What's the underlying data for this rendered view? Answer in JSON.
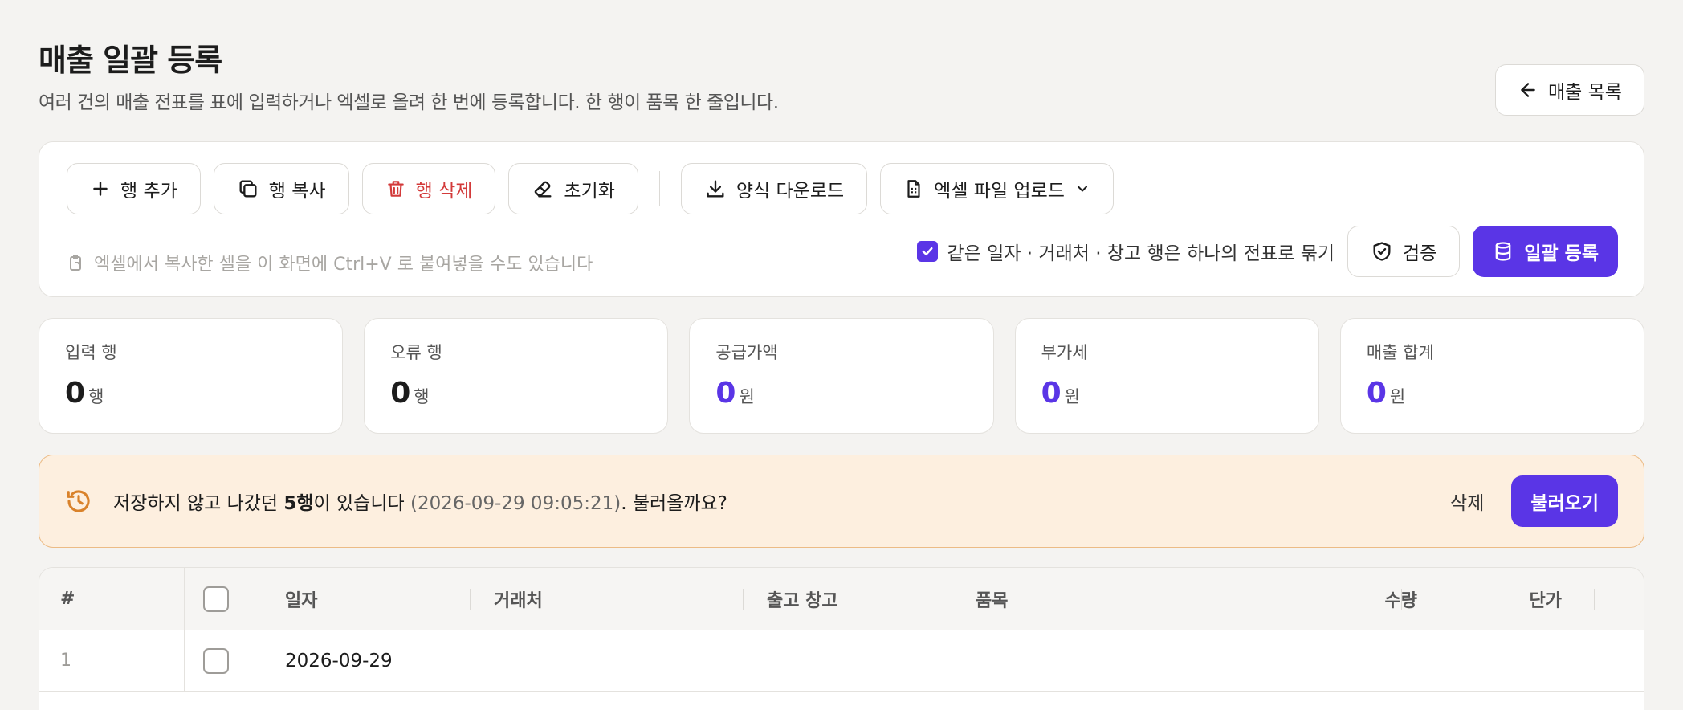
{
  "page": {
    "title": "매출 일괄 등록",
    "subtitle": "여러 건의 매출 전표를 표에 입력하거나 엑셀로 올려 한 번에 등록합니다. 한 행이 품목 한 줄입니다.",
    "back_label": "매출 목록"
  },
  "toolbar": {
    "add_row": "행 추가",
    "copy_row": "행 복사",
    "delete_row": "행 삭제",
    "reset": "초기화",
    "download_template": "양식 다운로드",
    "upload_excel": "엑셀 파일 업로드",
    "paste_hint": "엑셀에서 복사한 셀을 이 화면에 Ctrl+V 로 붙여넣을 수도 있습니다",
    "group_label": "같은 일자 · 거래처 · 창고 행은 하나의 전표로 묶기",
    "group_checked": true,
    "validate": "검증",
    "register": "일괄 등록"
  },
  "stats": [
    {
      "label": "입력 행",
      "value": "0",
      "unit": "행",
      "accent": false
    },
    {
      "label": "오류 행",
      "value": "0",
      "unit": "행",
      "accent": false
    },
    {
      "label": "공급가액",
      "value": "0",
      "unit": "원",
      "accent": true
    },
    {
      "label": "부가세",
      "value": "0",
      "unit": "원",
      "accent": true
    },
    {
      "label": "매출 합계",
      "value": "0",
      "unit": "원",
      "accent": true
    }
  ],
  "banner": {
    "prefix": "저장하지 않고 나갔던 ",
    "count": "5행",
    "middle": "이 있습니다 ",
    "timestamp": "(2026-09-29 09:05:21)",
    "suffix": ". 불러올까요?",
    "delete_label": "삭제",
    "load_label": "불러오기"
  },
  "table": {
    "headers": {
      "index": "#",
      "date": "일자",
      "customer": "거래처",
      "warehouse": "출고 창고",
      "item": "품목",
      "qty": "수량",
      "price": "단가"
    },
    "rows": [
      {
        "index": "1",
        "date": "2026-09-29",
        "customer": "",
        "warehouse": "",
        "item": "",
        "qty": "",
        "price": ""
      }
    ]
  },
  "colors": {
    "accent": "#5a35e6",
    "danger": "#d33a3a",
    "banner_bg": "#fdefdf",
    "banner_border": "#ecbb85",
    "history_icon": "#d9822b"
  }
}
